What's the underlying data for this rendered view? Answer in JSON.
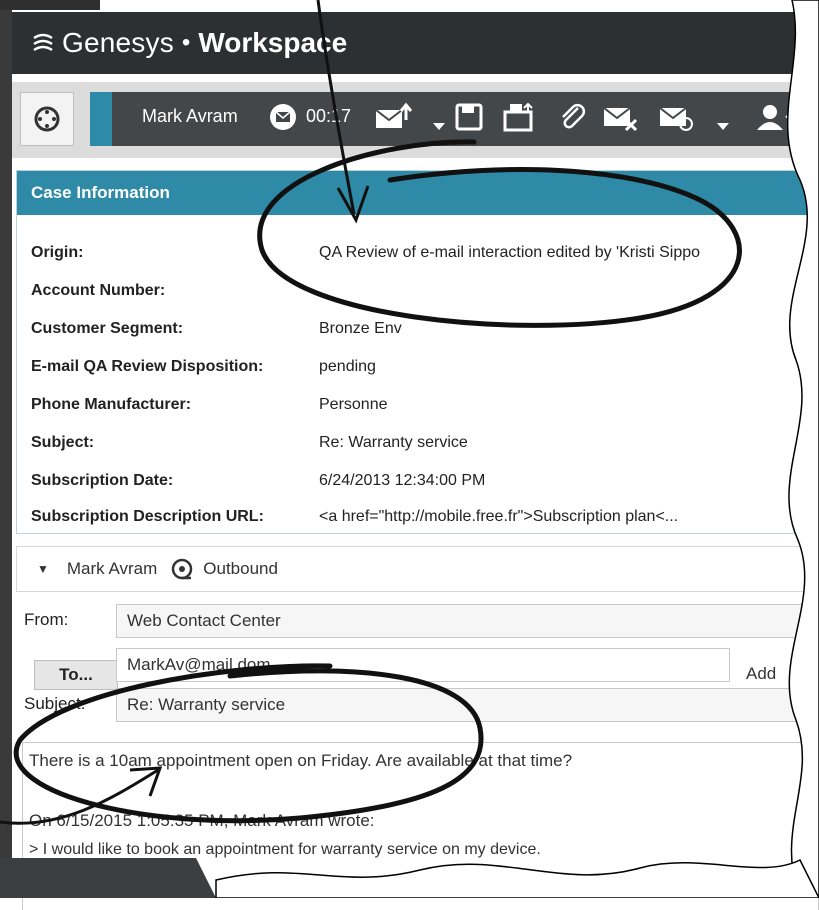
{
  "window": {
    "brand": "Genesys",
    "brand_separator": "•",
    "app_name": "Workspace"
  },
  "toolbar": {
    "contact_name": "Mark Avram",
    "timer": "00:17",
    "icons": [
      "team-communicator-icon",
      "email-icon",
      "reply-icon",
      "dropdown-arrow-icon",
      "save-icon",
      "workbin-icon",
      "attachment-icon",
      "mark-done-icon",
      "forward-icon",
      "dropdown-arrow-icon",
      "contact-icon"
    ]
  },
  "case_info": {
    "title": "Case Information",
    "rows": [
      {
        "label": "Origin:",
        "value": "QA Review of e-mail interaction edited by 'Kristi Sippo"
      },
      {
        "label": "Account Number:",
        "value": ""
      },
      {
        "label": "Customer Segment:",
        "value": "Bronze Env"
      },
      {
        "label": "E-mail QA Review Disposition:",
        "value": "pending"
      },
      {
        "label": "Phone Manufacturer:",
        "value": "Personne"
      },
      {
        "label": "Subject:",
        "value": "Re: Warranty service"
      },
      {
        "label": "Subscription Date:",
        "value": "6/24/2013 12:34:00 PM"
      },
      {
        "label": "Subscription Description URL:",
        "value": "<a href=\"http://mobile.free.fr\">Subscription plan<..."
      }
    ]
  },
  "interaction": {
    "party": "Mark Avram",
    "direction": "Outbound"
  },
  "email": {
    "from_label": "From:",
    "from_value": "Web Contact Center",
    "to_button": "To...",
    "to_value": "MarkAv@mail.dom",
    "add_label": "Add",
    "subject_label": "Subject:",
    "subject_value": "Re: Warranty service",
    "body_line1": "There is a 10am appointment open on Friday. Are available at that time?",
    "body_quote_header": "On 6/15/2015 1:05:35 PM, Mark Avram wrote:",
    "body_quote_line": "> I would like to book an appointment for warranty service on my device."
  },
  "colors": {
    "titlebar": "#2d3033",
    "accent": "#2e8aa6",
    "toolbar_strip": "#44474a"
  }
}
